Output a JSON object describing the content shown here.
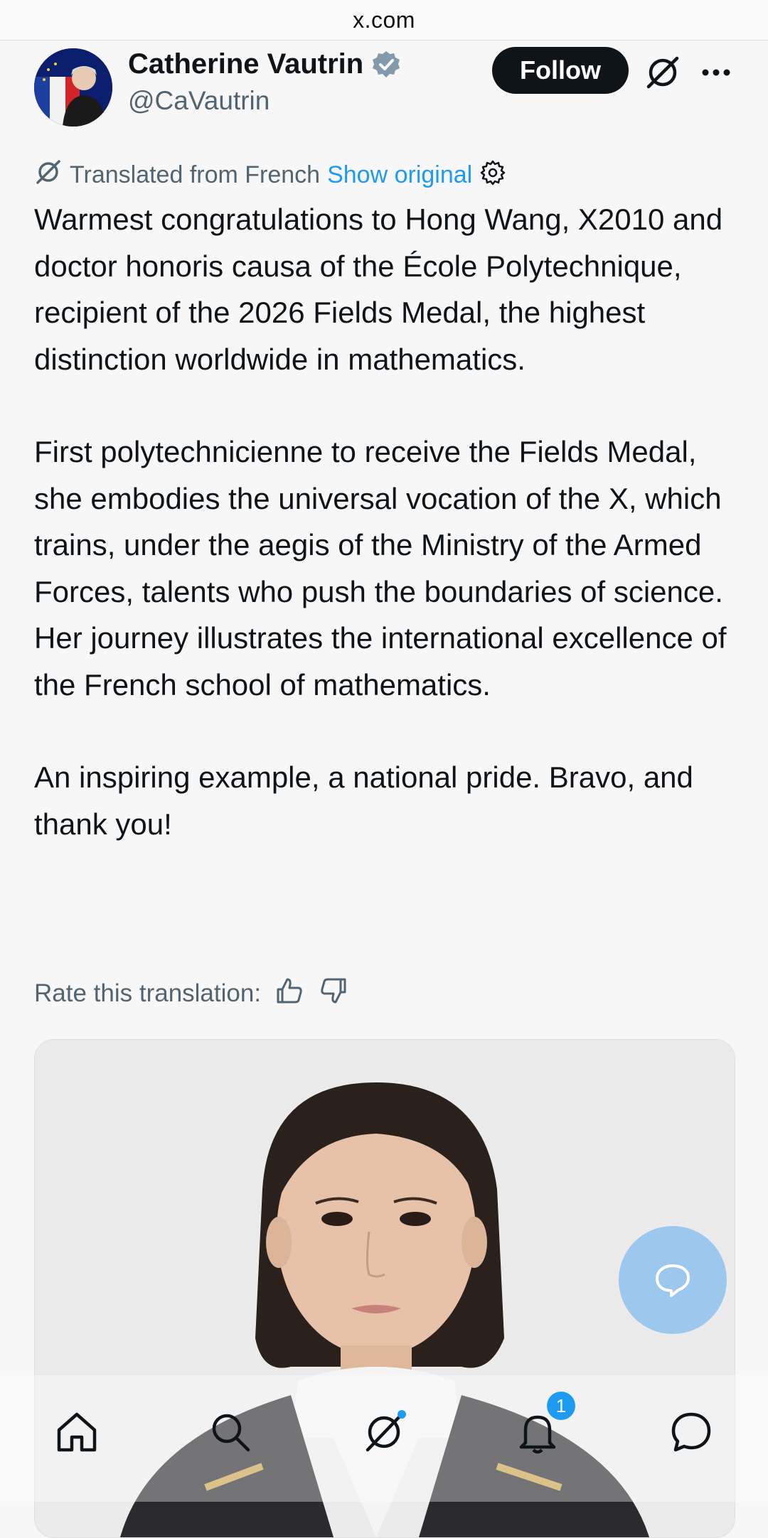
{
  "browser": {
    "url": "x.com"
  },
  "author": {
    "display_name": "Catherine Vautrin",
    "handle": "@CaVautrin",
    "verified": true
  },
  "header_actions": {
    "follow_label": "Follow",
    "grok_icon": "grok-icon",
    "more_icon": "more-icon"
  },
  "translation": {
    "label": "Translated from French",
    "show_original": "Show original",
    "rate_label": "Rate this translation:"
  },
  "tweet": {
    "paragraph_1": "Warmest congratulations to Hong Wang, X2010 and doctor honoris causa of the École Polytechnique, recipient of the 2026 Fields Medal, the highest distinction worldwide in mathematics.",
    "paragraph_2": "First polytechnicienne to receive the Fields Medal, she embodies the universal vocation of the X, which trains, under the aegis of the Ministry of the Armed Forces, talents who push the boundaries of science. Her journey illustrates the international excellence of the French school of mathematics.",
    "paragraph_3": "An inspiring example, a national pride. Bravo, and thank you!"
  },
  "bottom_nav": {
    "items": [
      "home-icon",
      "search-icon",
      "grok-icon",
      "notifications-icon",
      "messages-icon"
    ],
    "notification_count": "1"
  },
  "colors": {
    "link": "#1d9bf0",
    "secondary_text": "#536471",
    "primary_text": "#0f1419",
    "follow_bg": "#0f1419",
    "fab": "#9cc8ee"
  }
}
